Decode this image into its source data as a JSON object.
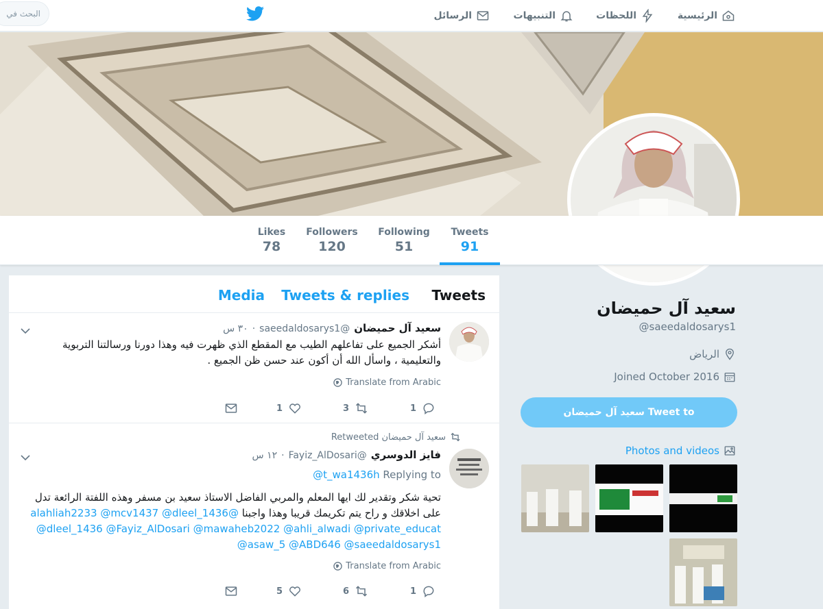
{
  "nav": {
    "home": "الرئيسية",
    "moments": "اللحظات",
    "notifications": "التنبيهات",
    "messages": "الرسائل",
    "search_placeholder": "البحث في"
  },
  "stats": [
    {
      "label": "Tweets",
      "value": "91"
    },
    {
      "label": "Following",
      "value": "51"
    },
    {
      "label": "Followers",
      "value": "120"
    },
    {
      "label": "Likes",
      "value": "78"
    }
  ],
  "profile": {
    "name": "سعيد آل حميضان",
    "handle": "@saeedaldosarys1",
    "location": "الرياض",
    "joined": "Joined October 2016",
    "tweet_to": "Tweet to سعيد آل حميضان",
    "photos_videos": "Photos and videos"
  },
  "timeline": {
    "tabs": [
      "Tweets",
      "Tweets & replies",
      "Media"
    ],
    "tweets": [
      {
        "name": "سعيد آل حميضان",
        "handle": "@saeedaldosarys1",
        "time": "٣٠ س",
        "text": "أشكر الجميع على تفاعلهم الطيب مع المقطع الذي ظهرت فيه وهذا دورنا ورسالتنا التربوية والتعليمية ، واسأل الله أن أكون عند حسن ظن الجميع .",
        "translate": "Translate from Arabic",
        "replies": "1",
        "retweets": "3",
        "likes": "1"
      },
      {
        "retweeted_by": "سعيد آل حميضان Retweeted",
        "name": "فايز الدوسري",
        "handle": "@Fayiz_AlDosari",
        "time": "١٢ س",
        "replying_label": "Replying to",
        "replying_to": "@t_wa1436h",
        "text_lead": "تحية شكر وتقدير لك ايها المعلم والمربي الفاضل الاستاذ سعيد بن مسفر وهذه اللفتة الرائعة تدل على اخلاقك  و راح يتم تكريمك قريبا وهذا واجبنا",
        "mentions": "@alahliah2233 @mcv1437 @dleel_1436 @dleel_1436 @Fayiz_AlDosari @mawaheb2022 @ahli_alwadi @private_educat @asaw_5 @ABD646 @saeedaldosarys1",
        "translate": "Translate from Arabic",
        "replies": "1",
        "retweets": "6",
        "likes": "5"
      }
    ]
  },
  "colors": {
    "accent": "#1da1f2",
    "muted": "#657786",
    "background": "#e6ecf0"
  }
}
